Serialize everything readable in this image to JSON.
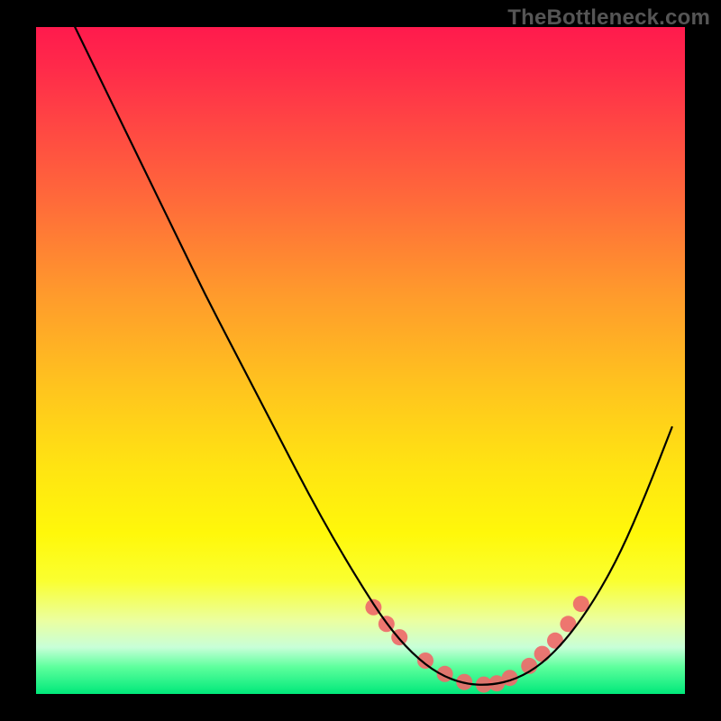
{
  "watermark": "TheBottleneck.com",
  "chart_data": {
    "type": "line",
    "title": "",
    "xlabel": "",
    "ylabel": "",
    "xlim": [
      0,
      100
    ],
    "ylim": [
      0,
      100
    ],
    "grid": false,
    "legend": false,
    "background_gradient": {
      "top": "#ff1a4d",
      "mid": "#ffe412",
      "bottom": "#00e87a"
    },
    "series": [
      {
        "name": "curve",
        "color": "#000000",
        "x": [
          6,
          10,
          14,
          18,
          22,
          26,
          30,
          34,
          38,
          42,
          46,
          50,
          54,
          58,
          62,
          66,
          70,
          74,
          78,
          82,
          86,
          90,
          94,
          98
        ],
        "y": [
          100,
          92,
          84,
          76,
          68,
          60,
          52.5,
          45,
          37.5,
          30,
          23,
          16.5,
          10.5,
          6,
          3,
          1.5,
          1.3,
          2.2,
          4.5,
          8.5,
          14,
          21,
          30,
          40
        ]
      },
      {
        "name": "markers",
        "type": "scatter",
        "color": "#ee6a6a",
        "radius": 9,
        "x": [
          52,
          54,
          56,
          60,
          63,
          66,
          69,
          71,
          73,
          76,
          78,
          80,
          82,
          84
        ],
        "y": [
          13,
          10.5,
          8.5,
          5,
          3,
          1.8,
          1.4,
          1.6,
          2.4,
          4.2,
          6,
          8,
          10.5,
          13.5
        ]
      }
    ]
  }
}
